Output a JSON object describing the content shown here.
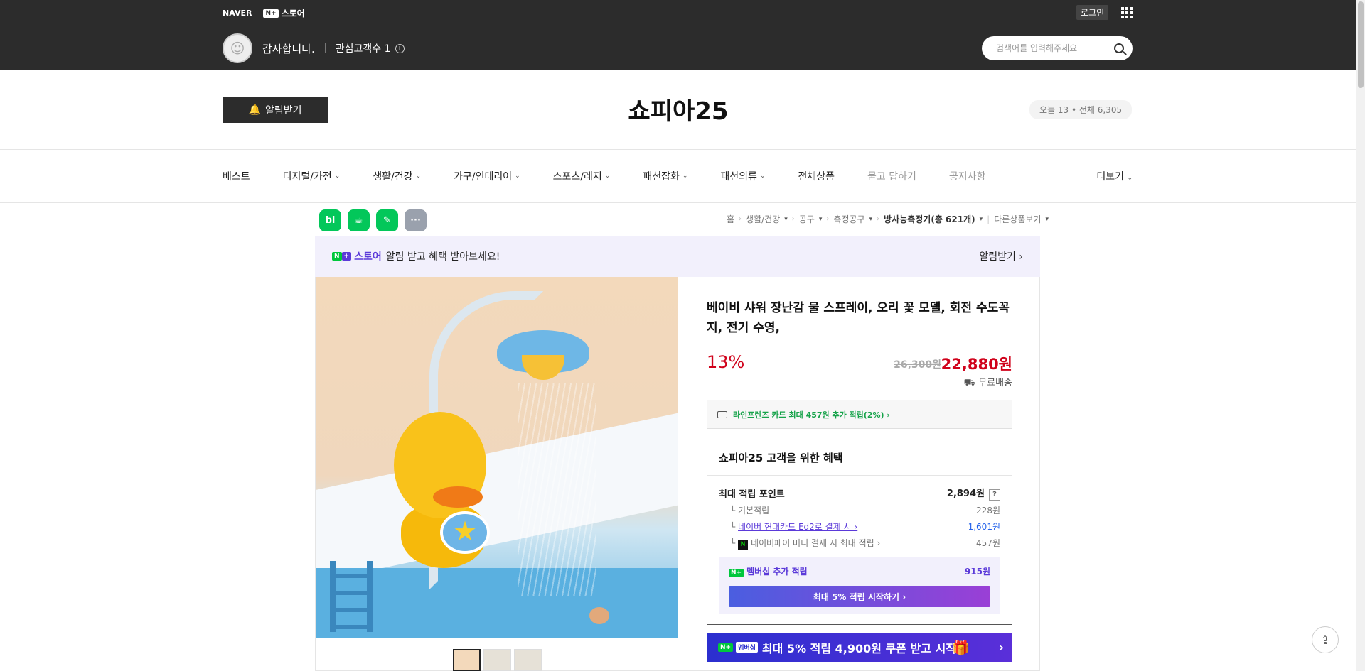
{
  "topbar": {
    "naver": "NAVER",
    "np_badge": "N+",
    "store_label": "스토어",
    "login": "로그인",
    "seller_name": "감사합니다.",
    "fans": "관심고객수 1",
    "search_placeholder": "검색어를 입력해주세요"
  },
  "store": {
    "notify_button": "알림받기",
    "title": "쇼피아25",
    "visits": "오늘 13 • 전체 6,305"
  },
  "gnb": {
    "items": [
      "베스트",
      "디지털/가전",
      "생활/건강",
      "가구/인테리어",
      "스포츠/레저",
      "패션잡화",
      "패션의류",
      "전체상품",
      "묻고 답하기",
      "공지사항"
    ],
    "more": "더보기"
  },
  "tools": [
    "bl",
    "☕",
    "✎",
    "···"
  ],
  "breadcrumb": {
    "home": "홈",
    "c1": "생활/건강",
    "c2": "공구",
    "c3": "측정공구",
    "c4": "방사능측정기(총 621개)",
    "other": "다른상품보기"
  },
  "promo": {
    "store": "스토어",
    "text": "알림 받고 혜택 받아보세요!",
    "link": "알림받기"
  },
  "product": {
    "title": "베이비 샤워 장난감 물 스프레이, 오리 꽃 모델, 회전 수도꼭지, 전기 수영,",
    "discount": "13%",
    "original_price": "26,300원",
    "sale_price": "22,880원",
    "shipping": "무료배송",
    "card_benefit": "라인프렌즈 카드 최대 457원 추가 적립(2%) ›"
  },
  "benefits": {
    "title": "쇼피아25 고객을 위한 혜택",
    "max_label": "최대 적립 포인트",
    "max_value": "2,894원",
    "basic_label": "기본적립",
    "basic_value": "228원",
    "card_label": "네이버 현대카드 Ed2로 결제 시 ›",
    "card_value": "1,601원",
    "pay_label": "네이버페이 머니 결제 시 최대 적립 ›",
    "pay_value": "457원",
    "member_label": "멤버십 추가 적립",
    "member_value": "915원",
    "member_button": "최대 5% 적립 시작하기 ›"
  },
  "coupon": {
    "badge": "멤버십",
    "text": "최대 5% 적립 4,900원 쿠폰 받고 시작"
  }
}
